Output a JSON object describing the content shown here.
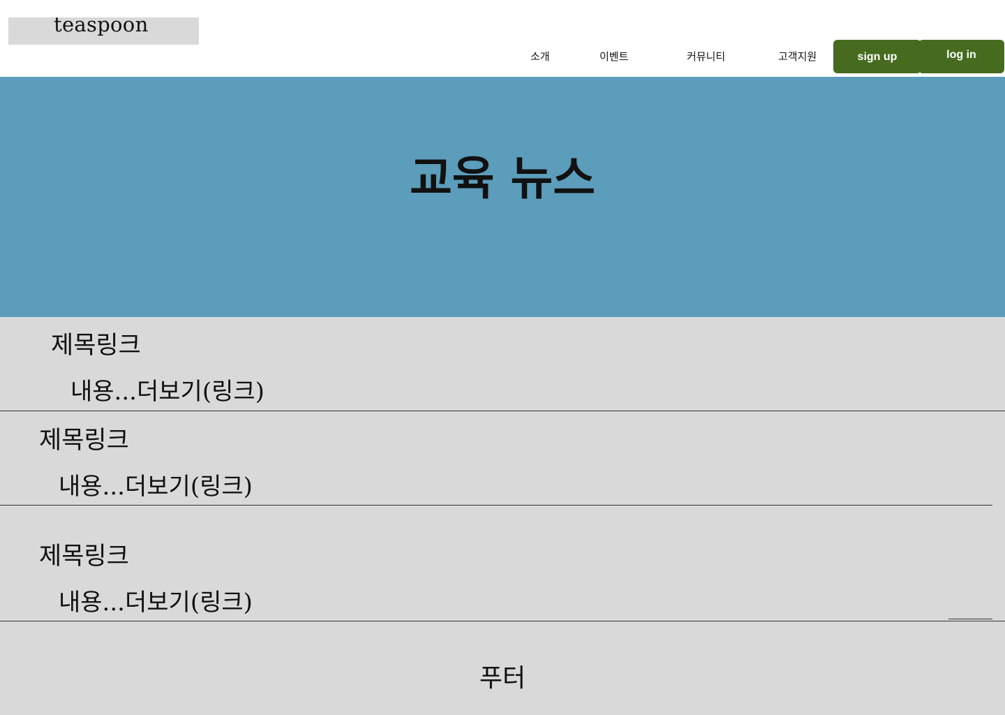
{
  "header": {
    "logo": "teaspoon",
    "nav": [
      "소개",
      "이벤트",
      "커뮤니티",
      "고객지원"
    ],
    "signup_label": "sign up",
    "login_label": "log in"
  },
  "hero": {
    "title": "교육 뉴스"
  },
  "news": {
    "items": [
      {
        "title": "제목링크",
        "more": "내용...더보기(링크)"
      },
      {
        "title": "제목링크",
        "more": "내용...더보기(링크)"
      },
      {
        "title": "제목링크",
        "more": "내용...더보기(링크)"
      }
    ]
  },
  "footer": {
    "text": "푸터"
  },
  "colors": {
    "hero_bg": "#5b9dba",
    "button_bg": "#466b1f",
    "content_bg": "#d9d9d9"
  }
}
